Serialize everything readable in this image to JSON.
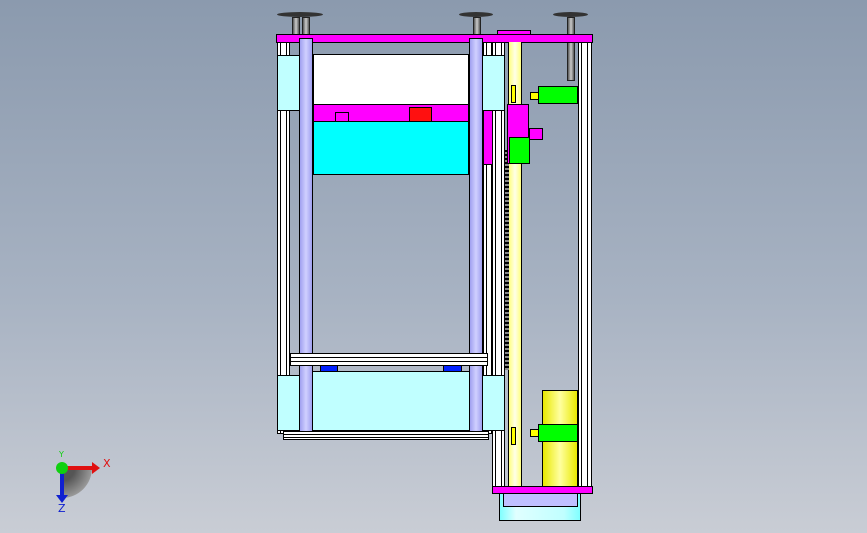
{
  "triad": {
    "x_label": "X",
    "y_label": "Y",
    "z_label": "Z",
    "x_color": "#e01010",
    "y_color": "#10d010",
    "z_color": "#1020d0"
  },
  "colors": {
    "frame_top": "#ff00ff",
    "panel_cyan": "#00ffff",
    "panel_light": "#c0ffff",
    "column": "#c0c0ff",
    "motor_green": "#00ff00",
    "motor_yellow": "#ffff00",
    "block_red": "#ff1010"
  }
}
